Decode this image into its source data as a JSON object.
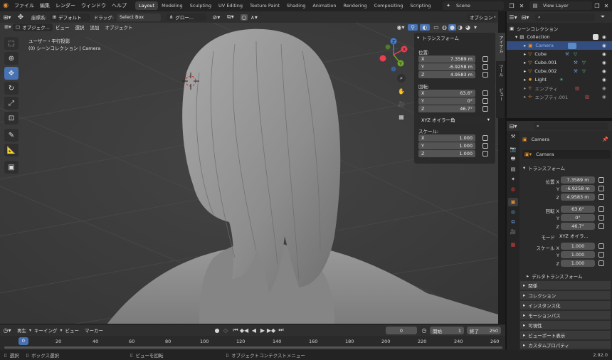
{
  "topbar": {
    "menus": [
      "ファイル",
      "編集",
      "レンダー",
      "ウィンドウ",
      "ヘルプ"
    ],
    "workspaces": [
      "Layout",
      "Modeling",
      "Sculpting",
      "UV Editing",
      "Texture Paint",
      "Shading",
      "Animation",
      "Rendering",
      "Compositing",
      "Scripting"
    ],
    "active_workspace": "Layout",
    "scene": "Scene",
    "view_layer": "View Layer"
  },
  "viewport_header": {
    "coord_label": "座標系:",
    "coord_value": "デフォルト",
    "drag_label": "ドラッグ:",
    "drag_value": "Select Box",
    "orient_value": "グロー...",
    "options": "オプション"
  },
  "viewport_subheader": {
    "mode": "オブジェク...",
    "menus": [
      "ビュー",
      "選択",
      "追加",
      "オブジェクト"
    ]
  },
  "viewport_info": {
    "view_name": "ユーザー・平行投影",
    "collection": "(0) シーンコレクション | Camera"
  },
  "gizmo": {
    "x": "X",
    "y": "Y",
    "z": "Z"
  },
  "npanel": {
    "title": "トランスフォーム",
    "location_label": "位置:",
    "location": [
      {
        "axis": "X",
        "value": "7.3589 m"
      },
      {
        "axis": "Y",
        "value": "-6.9258 m"
      },
      {
        "axis": "Z",
        "value": "4.9583 m"
      }
    ],
    "rotation_label": "回転:",
    "rotation": [
      {
        "axis": "X",
        "value": "63.6°"
      },
      {
        "axis": "Y",
        "value": "0°"
      },
      {
        "axis": "Z",
        "value": "46.7°"
      }
    ],
    "rotation_mode": "XYZ オイラー角",
    "scale_label": "スケール:",
    "scale": [
      {
        "axis": "X",
        "value": "1.000"
      },
      {
        "axis": "Y",
        "value": "1.000"
      },
      {
        "axis": "Z",
        "value": "1.000"
      }
    ],
    "tabs": [
      "アイテム",
      "ツール",
      "ビュー"
    ]
  },
  "outliner": {
    "root": "シーンコレクション",
    "collection": "Collection",
    "items": [
      {
        "name": "Camera",
        "selected": true
      },
      {
        "name": "Cube",
        "selected": false
      },
      {
        "name": "Cube.001",
        "selected": false
      },
      {
        "name": "Cube.002",
        "selected": false
      },
      {
        "name": "Light",
        "selected": false
      },
      {
        "name": "エンプティ",
        "selected": false
      },
      {
        "name": "エンプティ.001",
        "selected": false
      }
    ]
  },
  "properties": {
    "object_name": "Camera",
    "data_name": "Camera",
    "section": "トランスフォーム",
    "location_label": "位置 X",
    "location": [
      "7.3589 m",
      "-6.9258 m",
      "4.9583 m"
    ],
    "rotation_label": "回転 X",
    "rotation": [
      "63.6°",
      "0°",
      "46.7°"
    ],
    "mode_label": "モード",
    "mode_value": "XYZ オイラ...",
    "scale_label": "スケール X",
    "scale": [
      "1.000",
      "1.000",
      "1.000"
    ],
    "axis_y": "Y",
    "axis_z": "Z",
    "collapsed_sections": [
      "デルタトランスフォーム",
      "関係",
      "コレクション",
      "インスタンス化",
      "モーションパス",
      "可視性",
      "ビューポート表示",
      "カスタムプロパティ"
    ]
  },
  "timeline": {
    "menus": [
      "再生",
      "キーイング",
      "ビュー",
      "マーカー"
    ],
    "current_frame": "0",
    "start_label": "開始",
    "start": "1",
    "end_label": "終了",
    "end": "250",
    "ticks": [
      "0",
      "20",
      "40",
      "60",
      "80",
      "100",
      "120",
      "140",
      "160",
      "180",
      "200",
      "220",
      "240",
      "260"
    ]
  },
  "statusbar": {
    "select": "選択",
    "box_select": "ボックス選択",
    "rotate_view": "ビューを回転",
    "context_menu": "オブジェクトコンテクストメニュー",
    "version": "2.92.0"
  },
  "colors": {
    "accent": "#4772b3",
    "x_axis": "#e8404f",
    "y_axis": "#6ca52a",
    "z_axis": "#3d7fd9",
    "object_orange": "#e8902e"
  }
}
